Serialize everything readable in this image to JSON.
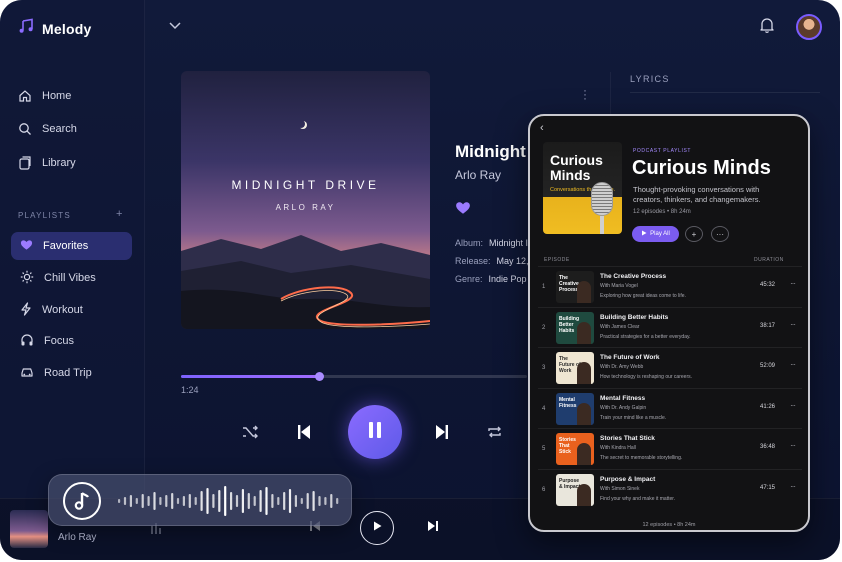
{
  "app": {
    "name": "Melody",
    "logo_icon": "music-note-icon",
    "accent": "#7a5cff"
  },
  "nav": [
    {
      "label": "Home",
      "icon": "home-icon"
    },
    {
      "label": "Search",
      "icon": "search-icon"
    },
    {
      "label": "Library",
      "icon": "library-icon"
    }
  ],
  "playlists": {
    "section_label": "PLAYLISTS",
    "add_label": "+",
    "items": [
      {
        "label": "Favorites",
        "icon": "heart-icon",
        "active": true
      },
      {
        "label": "Chill Vibes",
        "icon": "sun-icon",
        "active": false
      },
      {
        "label": "Workout",
        "icon": "bolt-icon",
        "active": false
      },
      {
        "label": "Focus",
        "icon": "headphones-icon",
        "active": false
      },
      {
        "label": "Road Trip",
        "icon": "car-icon",
        "active": false
      }
    ]
  },
  "now_playing": {
    "cover_title": "MIDNIGHT DRIVE",
    "cover_artist": "ARLO RAY",
    "title": "Midnight",
    "artist": "Arlo Ray",
    "album_label": "Album:",
    "album_value": "Midnight I",
    "release_label": "Release:",
    "release_value": "May 12, 2",
    "genre_label": "Genre:",
    "genre_value": "Indie Pop",
    "current_time": "1:24",
    "progress": 0.4
  },
  "lyrics": {
    "label": "LYRICS"
  },
  "bottom_bar": {
    "artist": "Arlo Ray"
  },
  "voice_waveform": [
    4,
    8,
    12,
    6,
    14,
    10,
    18,
    8,
    12,
    16,
    6,
    10,
    14,
    8,
    20,
    26,
    14,
    22,
    30,
    18,
    12,
    24,
    16,
    10,
    22,
    28,
    14,
    8,
    18,
    24,
    12,
    6,
    16,
    20,
    10,
    8,
    14,
    6
  ],
  "podcast": {
    "label": "PODCAST PLAYLIST",
    "title": "Curious Minds",
    "art_title": "Curious Minds",
    "art_subtitle": "Conversations that inspire.",
    "description": "Thought-provoking conversations with creators, thinkers, and changemakers.",
    "count_text": "12 episodes • 8h 24m",
    "play_all": "Play All",
    "episode_header": "EPISODE",
    "duration_header": "DURATION",
    "footer": "12 episodes • 8h 24m",
    "episodes": [
      {
        "num": "1",
        "thumb_text": "The Creative Process",
        "thumb_bg": "#1d1d1d",
        "thumb_fg": "#ffffff",
        "title": "The Creative Process",
        "guest": "With Maria Vogel",
        "desc": "Exploring how great ideas come to life.",
        "duration": "45:32"
      },
      {
        "num": "2",
        "thumb_text": "Building Better Habits",
        "thumb_bg": "#1f4a3f",
        "thumb_fg": "#ffffff",
        "title": "Building Better Habits",
        "guest": "With James Clear",
        "desc": "Practical strategies for a better everyday.",
        "duration": "38:17"
      },
      {
        "num": "3",
        "thumb_text": "The Future of Work",
        "thumb_bg": "#efe6d2",
        "thumb_fg": "#2a2a2a",
        "title": "The Future of Work",
        "guest": "With Dr. Amy Webb",
        "desc": "How technology is reshaping our careers.",
        "duration": "52:09"
      },
      {
        "num": "4",
        "thumb_text": "Mental Fitness",
        "thumb_bg": "#1f3d6e",
        "thumb_fg": "#ffffff",
        "title": "Mental Fitness",
        "guest": "With Dr. Andy Galpin",
        "desc": "Train your mind like a muscle.",
        "duration": "41:26"
      },
      {
        "num": "5",
        "thumb_text": "Stories That Stick",
        "thumb_bg": "#e9611e",
        "thumb_fg": "#ffffff",
        "title": "Stories That Stick",
        "guest": "With Kindra Hall",
        "desc": "The secret to memorable storytelling.",
        "duration": "36:48"
      },
      {
        "num": "6",
        "thumb_text": "Purpose & Impact",
        "thumb_bg": "#e9e6dc",
        "thumb_fg": "#1d1d1d",
        "title": "Purpose & Impact",
        "guest": "With Simon Sinek",
        "desc": "Find your why and make it matter.",
        "duration": "47:15"
      }
    ]
  }
}
